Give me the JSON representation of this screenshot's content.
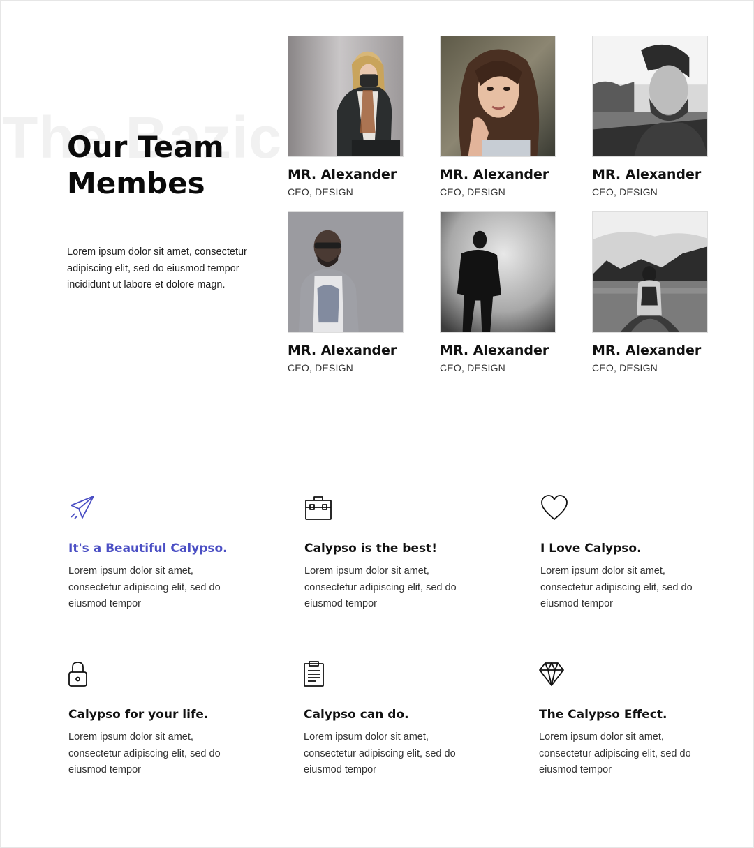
{
  "team_section": {
    "watermark": "The Bazic",
    "title_line1": "Our Team",
    "title_line2": "Membes",
    "intro": "Lorem ipsum dolor sit amet, consectetur adipiscing elit, sed do eiusmod tempor incididunt ut labore et dolore magn.",
    "members": [
      {
        "name": "MR. Alexander",
        "role": "CEO, DESIGN"
      },
      {
        "name": "MR. Alexander",
        "role": "CEO, DESIGN"
      },
      {
        "name": "MR. Alexander",
        "role": "CEO, DESIGN"
      },
      {
        "name": "MR. Alexander",
        "role": "CEO, DESIGN"
      },
      {
        "name": "MR. Alexander",
        "role": "CEO, DESIGN"
      },
      {
        "name": "MR. Alexander",
        "role": "CEO, DESIGN"
      }
    ]
  },
  "features_section": {
    "accent_color": "#4b4fc4",
    "items": [
      {
        "icon": "paper-plane-icon",
        "title": "It's a Beautiful Calypso.",
        "text": "Lorem ipsum dolor sit amet, consectetur adipiscing elit, sed do eiusmod tempor"
      },
      {
        "icon": "briefcase-icon",
        "title": "Calypso is the best!",
        "text": "Lorem ipsum dolor sit amet, consectetur adipiscing elit, sed do eiusmod tempor"
      },
      {
        "icon": "heart-icon",
        "title": "I Love Calypso.",
        "text": "Lorem ipsum dolor sit amet, consectetur adipiscing elit, sed do eiusmod tempor"
      },
      {
        "icon": "padlock-icon",
        "title": "Calypso for your life.",
        "text": "Lorem ipsum dolor sit amet, consectetur adipiscing elit, sed do eiusmod tempor"
      },
      {
        "icon": "clipboard-icon",
        "title": "Calypso can do.",
        "text": "Lorem ipsum dolor sit amet, consectetur adipiscing elit, sed do eiusmod tempor"
      },
      {
        "icon": "diamond-icon",
        "title": "The Calypso Effect.",
        "text": "Lorem ipsum dolor sit amet, consectetur adipiscing elit, sed do eiusmod tempor"
      }
    ]
  }
}
